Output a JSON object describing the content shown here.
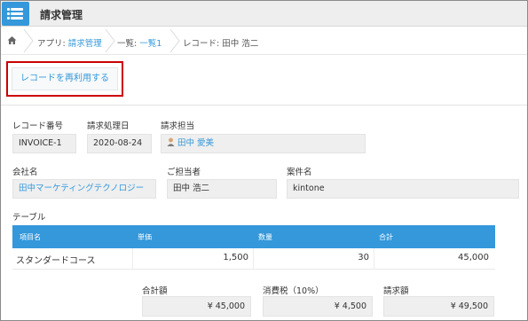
{
  "header": {
    "app_title": "請求管理"
  },
  "breadcrumb": {
    "app_prefix": "アプリ: ",
    "app_name": "請求管理",
    "list_prefix": "一覧: ",
    "list_name": "一覧1",
    "record_label": "レコード: 田中 浩二"
  },
  "toolbar": {
    "reuse_label": "レコードを再利用する"
  },
  "fields": {
    "record_no": {
      "label": "レコード番号",
      "value": "INVOICE-1"
    },
    "billing_date": {
      "label": "請求処理日",
      "value": "2020-08-24"
    },
    "billing_owner": {
      "label": "請求担当",
      "value": "田中 愛美"
    },
    "company": {
      "label": "会社名",
      "value": "田中マーケティングテクノロジー"
    },
    "contact": {
      "label": "ご担当者",
      "value": "田中 浩二"
    },
    "project": {
      "label": "案件名",
      "value": "kintone"
    }
  },
  "table": {
    "label": "テーブル",
    "headers": [
      "項目名",
      "単価",
      "数量",
      "合計"
    ],
    "rows": [
      [
        "スタンダードコース",
        "1,500",
        "30",
        "45,000"
      ]
    ]
  },
  "totals": {
    "subtotal": {
      "label": "合計額",
      "value": "¥ 45,000"
    },
    "tax": {
      "label": "消費税（10%）",
      "value": "¥ 4,500"
    },
    "total": {
      "label": "請求額",
      "value": "¥ 49,500"
    }
  },
  "colors": {
    "accent": "#3498db",
    "highlight_border": "#cc0000"
  }
}
